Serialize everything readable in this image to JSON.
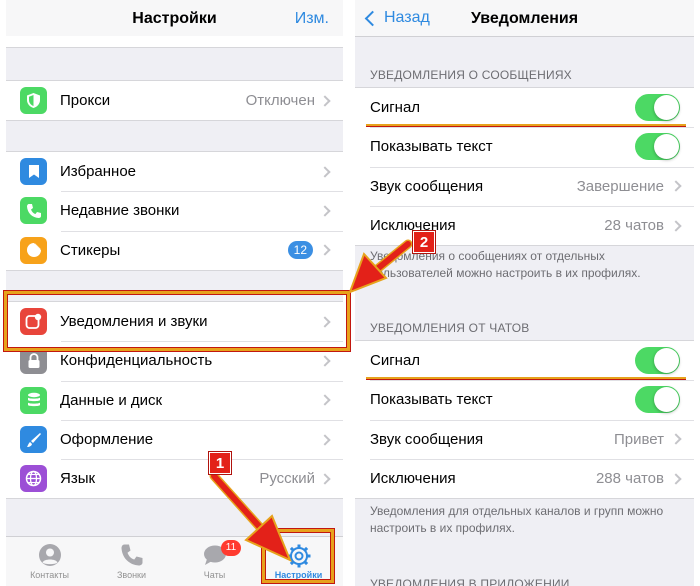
{
  "left": {
    "nav": {
      "title": "Настройки",
      "edit": "Изм."
    },
    "proxy": {
      "label": "Прокси",
      "value": "Отключен",
      "color": "#4cd964",
      "icon": "shield-icon"
    },
    "group1": [
      {
        "label": "Избранное",
        "color": "#2f8ae0",
        "icon": "bookmark-icon"
      },
      {
        "label": "Недавние звонки",
        "color": "#4cd964",
        "icon": "phone-icon"
      },
      {
        "label": "Стикеры",
        "color": "#f7a21a",
        "icon": "sticker-icon",
        "badge": "12"
      }
    ],
    "group2": [
      {
        "label": "Уведомления и звуки",
        "color": "#e8453b",
        "icon": "notification-icon"
      },
      {
        "label": "Конфиденциальность",
        "color": "#8e8e93",
        "icon": "lock-icon"
      },
      {
        "label": "Данные и диск",
        "color": "#4cd964",
        "icon": "database-icon"
      },
      {
        "label": "Оформление",
        "color": "#2f8ae0",
        "icon": "brush-icon"
      },
      {
        "label": "Язык",
        "value": "Русский",
        "color": "#9c4fd6",
        "icon": "globe-icon"
      }
    ],
    "tabs": [
      {
        "label": "Контакты",
        "icon": "person-icon"
      },
      {
        "label": "Звонки",
        "icon": "phone-icon"
      },
      {
        "label": "Чаты",
        "icon": "chat-bubble-icon",
        "badge": "11"
      },
      {
        "label": "Настройки",
        "icon": "gear-icon",
        "active": true
      }
    ]
  },
  "right": {
    "nav": {
      "back": "Назад",
      "title": "Уведомления"
    },
    "messages": {
      "header": "УВЕДОМЛЕНИЯ О СООБЩЕНИЯХ",
      "rows": [
        {
          "label": "Сигнал",
          "toggle": true
        },
        {
          "label": "Показывать текст",
          "toggle": true
        },
        {
          "label": "Звук сообщения",
          "value": "Завершение"
        },
        {
          "label": "Исключения",
          "value": "28 чатов"
        }
      ],
      "footnote": "Уведомления о сообщениях от отдельных пользователей можно настроить в их профилях."
    },
    "chats": {
      "header": "УВЕДОМЛЕНИЯ ОТ ЧАТОВ",
      "rows": [
        {
          "label": "Сигнал",
          "toggle": true
        },
        {
          "label": "Показывать текст",
          "toggle": true
        },
        {
          "label": "Звук сообщения",
          "value": "Привет"
        },
        {
          "label": "Исключения",
          "value": "288 чатов"
        }
      ],
      "footnote": "Уведомления для отдельных каналов и групп можно настроить в их профилях."
    },
    "cut_header": "УВЕДОМЛЕНИЯ В ПРИЛОЖЕНИИ"
  },
  "annotations": {
    "step1": "1",
    "step2": "2",
    "accent": "#e7a21c",
    "arrow": "#e32119"
  }
}
